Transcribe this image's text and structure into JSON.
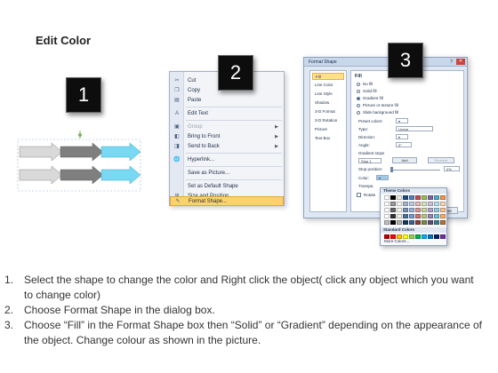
{
  "title": "Edit Color",
  "badges": [
    "1",
    "2",
    "3"
  ],
  "colors": {
    "arrow_gray": "#a6a6a6",
    "arrow_dark": "#7f7f7f",
    "arrow_cyan": "#79d8f2",
    "menu_highlight": "#fbd36a"
  },
  "context_menu": {
    "items": [
      {
        "icon": "scissors-icon",
        "label": "Cut"
      },
      {
        "icon": "copy-icon",
        "label": "Copy"
      },
      {
        "icon": "paste-icon",
        "label": "Paste"
      },
      {
        "icon": "edit-text-icon",
        "label": "Edit Text"
      },
      {
        "icon": "group-icon",
        "label": "Group"
      },
      {
        "icon": "bring-front-icon",
        "label": "Bring to Front"
      },
      {
        "icon": "send-back-icon",
        "label": "Send to Back"
      },
      {
        "icon": "hyperlink-icon",
        "label": "Hyperlink..."
      },
      {
        "icon": "",
        "label": "Save as Picture..."
      },
      {
        "icon": "",
        "label": "Set as Default Shape"
      },
      {
        "icon": "size-icon",
        "label": "Size and Position..."
      },
      {
        "icon": "format-shape-icon",
        "label": "Format Shape..."
      }
    ]
  },
  "dialog": {
    "title": "Format Shape",
    "categories": [
      "Fill",
      "Line Color",
      "Line Style",
      "Shadow",
      "3-D Format",
      "3-D Rotation",
      "Picture",
      "Text Box"
    ],
    "section": "Fill",
    "options": [
      "No fill",
      "Solid fill",
      "Gradient fill",
      "Picture or texture fill",
      "Slide background fill"
    ],
    "preset_label": "Preset colors:",
    "type_label": "Type:",
    "type_value": "Linear",
    "direction_label": "Direction:",
    "angle_label": "Angle:",
    "angle_value": "0°",
    "stops_label": "Gradient stops",
    "stop_value": "Stop 1",
    "add_label": "Add",
    "remove_label": "Remove",
    "stop_position_label": "Stop position:",
    "stop_position_value": "0%",
    "color_label": "Color:",
    "transparency_label": "Transpa",
    "rotate_label": "Rotate",
    "close_label": "Close"
  },
  "color_picker": {
    "theme_header": "Theme Colors",
    "standard_header": "Standard Colors",
    "more_label": "More Colors...",
    "theme_top": [
      "#ffffff",
      "#000000",
      "#eeece1",
      "#1f497d",
      "#4f81bd",
      "#c0504d",
      "#9bbb59",
      "#8064a2",
      "#4bacc6",
      "#f79646"
    ],
    "standard": [
      "#c00000",
      "#ff0000",
      "#ffc000",
      "#ffff00",
      "#92d050",
      "#00b050",
      "#00b0f0",
      "#0070c0",
      "#002060",
      "#7030a0"
    ]
  },
  "instructions": [
    {
      "num": "1.",
      "text": "Select the shape to change the color and Right click the object( click any object which you want to change color)"
    },
    {
      "num": "2.",
      "text": "Choose Format Shape in the dialog box."
    },
    {
      "num": "3.",
      "text": "Choose “Fill” in the Format Shape box then “Solid” or “Gradient” depending on the appearance of the object. Change colour as shown in the picture."
    }
  ]
}
